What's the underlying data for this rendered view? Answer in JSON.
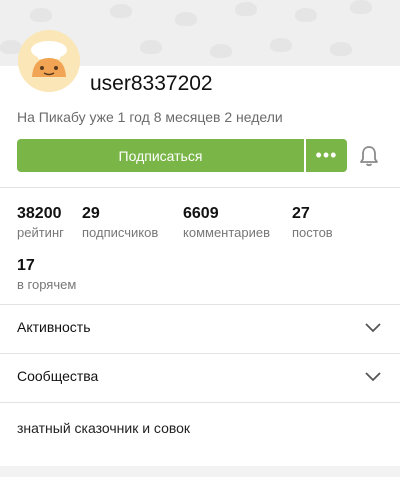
{
  "profile": {
    "username": "user8337202",
    "since": "На Пикабу уже 1 год 8 месяцев 2 недели",
    "bio": "знатный сказочник и совок"
  },
  "actions": {
    "subscribe_label": "Подписаться",
    "more_label": "•••"
  },
  "stats": [
    {
      "value": "38200",
      "label": "рейтинг"
    },
    {
      "value": "29",
      "label": "подписчиков"
    },
    {
      "value": "6609",
      "label": "комментариев"
    },
    {
      "value": "27",
      "label": "постов"
    },
    {
      "value": "17",
      "label": "в горячем"
    }
  ],
  "sections": [
    {
      "title": "Активность"
    },
    {
      "title": "Сообщества"
    }
  ],
  "colors": {
    "accent": "#7ab547",
    "banner": "#efefef"
  },
  "icons": {
    "more": "more-dots-icon",
    "bell": "bell-icon",
    "chevron": "chevron-down-icon"
  }
}
